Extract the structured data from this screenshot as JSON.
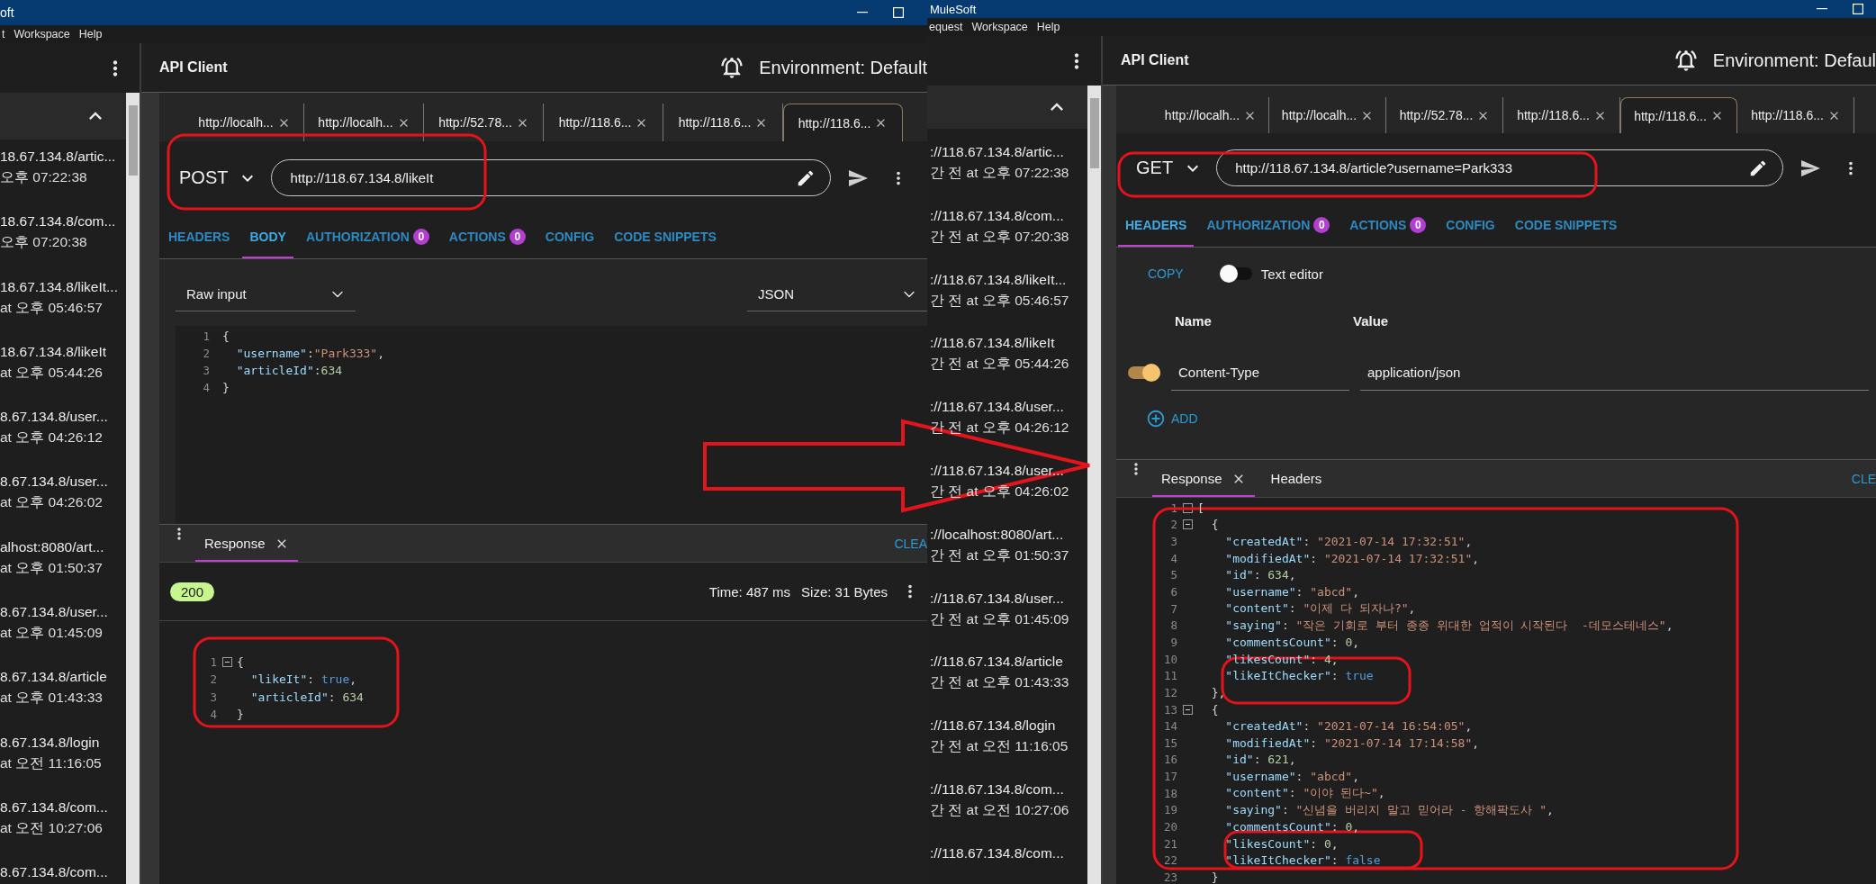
{
  "windows": [
    {
      "title": "oft",
      "menu": [
        "t",
        "Workspace",
        "Help"
      ],
      "sidebar": {
        "items": [
          {
            "url": "18.67.134.8/artic...",
            "time": "오후 07:22:38"
          },
          {
            "url": "18.67.134.8/com...",
            "time": "오후 07:20:38"
          },
          {
            "url": "18.67.134.8/likeIt...",
            "time": "at 오후 05:46:57"
          },
          {
            "url": "18.67.134.8/likeIt",
            "time": "at 오후 05:44:26"
          },
          {
            "url": "8.67.134.8/user...",
            "time": "at 오후 04:26:12"
          },
          {
            "url": "8.67.134.8/user...",
            "time": "at 오후 04:26:02"
          },
          {
            "url": "alhost:8080/art...",
            "time": "at 오후 01:50:37"
          },
          {
            "url": "8.67.134.8/user...",
            "time": "at 오후 01:45:09"
          },
          {
            "url": "8.67.134.8/article",
            "time": "at 오후 01:43:33"
          },
          {
            "url": "8.67.134.8/login",
            "time": "at 오전 11:16:05"
          },
          {
            "url": "8.67.134.8/com...",
            "time": "at 오전 10:27:06"
          },
          {
            "url": "8.67.134.8/com..."
          }
        ]
      },
      "header": {
        "title": "API Client",
        "environment": "Environment: Default"
      },
      "tabs": [
        {
          "label": "http://localh...",
          "selected": false
        },
        {
          "label": "http://localh...",
          "selected": false
        },
        {
          "label": "http://52.78...",
          "selected": false
        },
        {
          "label": "http://118.6...",
          "selected": false
        },
        {
          "label": "http://118.6...",
          "selected": false
        },
        {
          "label": "http://118.6...",
          "selected": true
        }
      ],
      "request": {
        "method": "POST",
        "url": "http://118.67.134.8/likeIt"
      },
      "request_tabs": [
        {
          "label": "HEADERS",
          "selected": false
        },
        {
          "label": "BODY",
          "selected": true
        },
        {
          "label": "AUTHORIZATION",
          "badge": "0",
          "selected": false
        },
        {
          "label": "ACTIONS",
          "badge": "0",
          "selected": false
        },
        {
          "label": "CONFIG",
          "selected": false
        },
        {
          "label": "CODE SNIPPETS",
          "selected": false
        }
      ],
      "panel": {
        "kind": "body",
        "input_type": "Raw input",
        "format": "JSON",
        "lines": [
          {
            "number": "1",
            "parts": [
              {
                "kind": "punct",
                "text": "{"
              }
            ]
          },
          {
            "number": "2",
            "parts": [
              {
                "kind": "key",
                "text": "  \"username\""
              },
              {
                "kind": "punct",
                "text": ":"
              },
              {
                "kind": "string",
                "text": "\"Park333\""
              },
              {
                "kind": "punct",
                "text": ","
              }
            ]
          },
          {
            "number": "3",
            "parts": [
              {
                "kind": "key",
                "text": "  \"articleId\""
              },
              {
                "kind": "punct",
                "text": ":"
              },
              {
                "kind": "number",
                "text": "634"
              }
            ]
          },
          {
            "number": "4",
            "parts": [
              {
                "kind": "punct",
                "text": "}"
              }
            ]
          }
        ]
      },
      "response": {
        "tabs": [
          {
            "label": "Response",
            "closable": true,
            "selected": true
          }
        ],
        "clear": "CLEA",
        "status": "200",
        "time": "Time: 487 ms",
        "size": "Size: 31 Bytes",
        "lines": [
          {
            "number": "1",
            "collapsible": true,
            "parts": [
              {
                "kind": "punct",
                "text": "{"
              }
            ]
          },
          {
            "number": "2",
            "collapsible": false,
            "parts": [
              {
                "kind": "key",
                "text": "  \"likeIt\""
              },
              {
                "kind": "punct",
                "text": ": "
              },
              {
                "kind": "boolean",
                "text": "true"
              },
              {
                "kind": "punct",
                "text": ","
              }
            ]
          },
          {
            "number": "3",
            "collapsible": false,
            "parts": [
              {
                "kind": "key",
                "text": "  \"articleId\""
              },
              {
                "kind": "punct",
                "text": ": "
              },
              {
                "kind": "number",
                "text": "634"
              }
            ]
          },
          {
            "number": "4",
            "collapsible": false,
            "parts": [
              {
                "kind": "punct",
                "text": "}"
              }
            ]
          }
        ]
      }
    },
    {
      "title": "MuleSoft",
      "menu": [
        "equest",
        "Workspace",
        "Help"
      ],
      "sidebar": {
        "items": [
          {
            "url": "://118.67.134.8/artic...",
            "time": "간 전 at 오후 07:22:38"
          },
          {
            "url": "://118.67.134.8/com...",
            "time": "간 전 at 오후 07:20:38"
          },
          {
            "url": "://118.67.134.8/likeIt...",
            "time": "간 전 at 오후 05:46:57"
          },
          {
            "url": "://118.67.134.8/likeIt",
            "time": "간 전 at 오후 05:44:26"
          },
          {
            "url": "://118.67.134.8/user...",
            "time": "간 전 at 오후 04:26:12"
          },
          {
            "url": "://118.67.134.8/user...",
            "time": "간 전 at 오후 04:26:02"
          },
          {
            "url": "://localhost:8080/art...",
            "time": "간 전 at 오후 01:50:37"
          },
          {
            "url": "://118.67.134.8/user...",
            "time": "간 전 at 오후 01:45:09"
          },
          {
            "url": "://118.67.134.8/article",
            "time": "간 전 at 오후 01:43:33"
          },
          {
            "url": "://118.67.134.8/login",
            "time": "간 전 at 오전 11:16:05"
          },
          {
            "url": "://118.67.134.8/com...",
            "time": "간 전 at 오전 10:27:06"
          },
          {
            "url": "://118.67.134.8/com..."
          }
        ]
      },
      "header": {
        "title": "API Client",
        "environment": "Environment: Defaul"
      },
      "tabs": [
        {
          "label": "http://localh...",
          "selected": false
        },
        {
          "label": "http://localh...",
          "selected": false
        },
        {
          "label": "http://52.78...",
          "selected": false
        },
        {
          "label": "http://118.6...",
          "selected": false
        },
        {
          "label": "http://118.6...",
          "selected": true
        },
        {
          "label": "http://118.6...",
          "selected": false
        }
      ],
      "request": {
        "method": "GET",
        "url": "http://118.67.134.8/article?username=Park333"
      },
      "request_tabs": [
        {
          "label": "HEADERS",
          "selected": true
        },
        {
          "label": "AUTHORIZATION",
          "badge": "0",
          "selected": false
        },
        {
          "label": "ACTIONS",
          "badge": "0",
          "selected": false
        },
        {
          "label": "CONFIG",
          "selected": false
        },
        {
          "label": "CODE SNIPPETS",
          "selected": false
        }
      ],
      "panel": {
        "kind": "headers",
        "copy": "COPY",
        "text_editor": {
          "label": "Text editor",
          "on": false
        },
        "columns": [
          "Name",
          "Value"
        ],
        "rows": [
          {
            "enabled": true,
            "name": "Content-Type",
            "value": "application/json"
          }
        ],
        "add": "ADD"
      },
      "response": {
        "tabs": [
          {
            "label": "Response",
            "closable": true,
            "selected": true
          },
          {
            "label": "Headers",
            "closable": false,
            "selected": false
          }
        ],
        "clear": "CLE",
        "lines": [
          {
            "number": "1",
            "collapsible": true,
            "parts": [
              {
                "kind": "punct",
                "text": "["
              }
            ]
          },
          {
            "number": "2",
            "collapsible": true,
            "parts": [
              {
                "kind": "punct",
                "text": "  {"
              }
            ]
          },
          {
            "number": "3",
            "collapsible": false,
            "parts": [
              {
                "kind": "key",
                "text": "    \"createdAt\""
              },
              {
                "kind": "punct",
                "text": ": "
              },
              {
                "kind": "string",
                "text": "\"2021-07-14 17:32:51\""
              },
              {
                "kind": "punct",
                "text": ","
              }
            ]
          },
          {
            "number": "4",
            "collapsible": false,
            "parts": [
              {
                "kind": "key",
                "text": "    \"modifiedAt\""
              },
              {
                "kind": "punct",
                "text": ": "
              },
              {
                "kind": "string",
                "text": "\"2021-07-14 17:32:51\""
              },
              {
                "kind": "punct",
                "text": ","
              }
            ]
          },
          {
            "number": "5",
            "collapsible": false,
            "parts": [
              {
                "kind": "key",
                "text": "    \"id\""
              },
              {
                "kind": "punct",
                "text": ": "
              },
              {
                "kind": "number",
                "text": "634"
              },
              {
                "kind": "punct",
                "text": ","
              }
            ]
          },
          {
            "number": "6",
            "collapsible": false,
            "parts": [
              {
                "kind": "key",
                "text": "    \"username\""
              },
              {
                "kind": "punct",
                "text": ": "
              },
              {
                "kind": "string",
                "text": "\"abcd\""
              },
              {
                "kind": "punct",
                "text": ","
              }
            ]
          },
          {
            "number": "7",
            "collapsible": false,
            "parts": [
              {
                "kind": "key",
                "text": "    \"content\""
              },
              {
                "kind": "punct",
                "text": ": "
              },
              {
                "kind": "string",
                "text": "\"이제 다 되자나?\""
              },
              {
                "kind": "punct",
                "text": ","
              }
            ]
          },
          {
            "number": "8",
            "collapsible": false,
            "parts": [
              {
                "kind": "key",
                "text": "    \"saying\""
              },
              {
                "kind": "punct",
                "text": ": "
              },
              {
                "kind": "string",
                "text": "\"작은 기회로 부터 종종 위대한 업적이 시작된다  -데모스테네스\""
              },
              {
                "kind": "punct",
                "text": ","
              }
            ]
          },
          {
            "number": "9",
            "collapsible": false,
            "parts": [
              {
                "kind": "key",
                "text": "    \"commentsCount\""
              },
              {
                "kind": "punct",
                "text": ": "
              },
              {
                "kind": "number",
                "text": "0"
              },
              {
                "kind": "punct",
                "text": ","
              }
            ]
          },
          {
            "number": "10",
            "collapsible": false,
            "parts": [
              {
                "kind": "key",
                "text": "    \"likesCount\""
              },
              {
                "kind": "punct",
                "text": ": "
              },
              {
                "kind": "number",
                "text": "4"
              },
              {
                "kind": "punct",
                "text": ","
              }
            ]
          },
          {
            "number": "11",
            "collapsible": false,
            "parts": [
              {
                "kind": "key",
                "text": "    \"likeItChecker\""
              },
              {
                "kind": "punct",
                "text": ": "
              },
              {
                "kind": "boolean",
                "text": "true"
              }
            ]
          },
          {
            "number": "12",
            "collapsible": false,
            "parts": [
              {
                "kind": "punct",
                "text": "  },"
              }
            ]
          },
          {
            "number": "13",
            "collapsible": true,
            "parts": [
              {
                "kind": "punct",
                "text": "  {"
              }
            ]
          },
          {
            "number": "14",
            "collapsible": false,
            "parts": [
              {
                "kind": "key",
                "text": "    \"createdAt\""
              },
              {
                "kind": "punct",
                "text": ": "
              },
              {
                "kind": "string",
                "text": "\"2021-07-14 16:54:05\""
              },
              {
                "kind": "punct",
                "text": ","
              }
            ]
          },
          {
            "number": "15",
            "collapsible": false,
            "parts": [
              {
                "kind": "key",
                "text": "    \"modifiedAt\""
              },
              {
                "kind": "punct",
                "text": ": "
              },
              {
                "kind": "string",
                "text": "\"2021-07-14 17:14:58\""
              },
              {
                "kind": "punct",
                "text": ","
              }
            ]
          },
          {
            "number": "16",
            "collapsible": false,
            "parts": [
              {
                "kind": "key",
                "text": "    \"id\""
              },
              {
                "kind": "punct",
                "text": ": "
              },
              {
                "kind": "number",
                "text": "621"
              },
              {
                "kind": "punct",
                "text": ","
              }
            ]
          },
          {
            "number": "17",
            "collapsible": false,
            "parts": [
              {
                "kind": "key",
                "text": "    \"username\""
              },
              {
                "kind": "punct",
                "text": ": "
              },
              {
                "kind": "string",
                "text": "\"abcd\""
              },
              {
                "kind": "punct",
                "text": ","
              }
            ]
          },
          {
            "number": "18",
            "collapsible": false,
            "parts": [
              {
                "kind": "key",
                "text": "    \"content\""
              },
              {
                "kind": "punct",
                "text": ": "
              },
              {
                "kind": "string",
                "text": "\"이야 된다~\""
              },
              {
                "kind": "punct",
                "text": ","
              }
            ]
          },
          {
            "number": "19",
            "collapsible": false,
            "parts": [
              {
                "kind": "key",
                "text": "    \"saying\""
              },
              {
                "kind": "punct",
                "text": ": "
              },
              {
                "kind": "string",
                "text": "\"신념을 버리지 말고 믿어라 - 항해팍도사 \""
              },
              {
                "kind": "punct",
                "text": ","
              }
            ]
          },
          {
            "number": "20",
            "collapsible": false,
            "parts": [
              {
                "kind": "key",
                "text": "    \"commentsCount\""
              },
              {
                "kind": "punct",
                "text": ": "
              },
              {
                "kind": "number",
                "text": "0"
              },
              {
                "kind": "punct",
                "text": ","
              }
            ]
          },
          {
            "number": "21",
            "collapsible": false,
            "parts": [
              {
                "kind": "key",
                "text": "    \"likesCount\""
              },
              {
                "kind": "punct",
                "text": ": "
              },
              {
                "kind": "number",
                "text": "0"
              },
              {
                "kind": "punct",
                "text": ","
              }
            ]
          },
          {
            "number": "22",
            "collapsible": false,
            "parts": [
              {
                "kind": "key",
                "text": "    \"likeItChecker\""
              },
              {
                "kind": "punct",
                "text": ": "
              },
              {
                "kind": "boolean",
                "text": "false"
              }
            ]
          },
          {
            "number": "23",
            "collapsible": false,
            "parts": [
              {
                "kind": "punct",
                "text": "  }"
              }
            ]
          }
        ]
      }
    }
  ]
}
